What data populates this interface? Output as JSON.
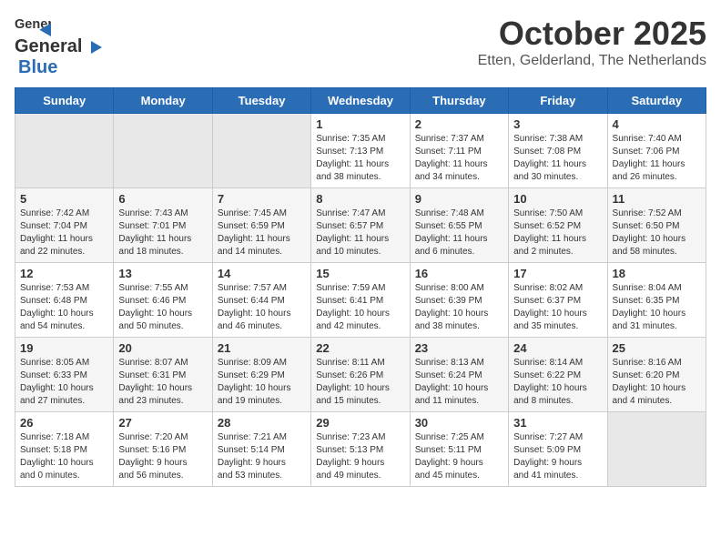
{
  "logo": {
    "general": "General",
    "blue": "Blue"
  },
  "title": "October 2025",
  "subtitle": "Etten, Gelderland, The Netherlands",
  "days_of_week": [
    "Sunday",
    "Monday",
    "Tuesday",
    "Wednesday",
    "Thursday",
    "Friday",
    "Saturday"
  ],
  "weeks": [
    [
      {
        "day": "",
        "info": ""
      },
      {
        "day": "",
        "info": ""
      },
      {
        "day": "",
        "info": ""
      },
      {
        "day": "1",
        "info": "Sunrise: 7:35 AM\nSunset: 7:13 PM\nDaylight: 11 hours\nand 38 minutes."
      },
      {
        "day": "2",
        "info": "Sunrise: 7:37 AM\nSunset: 7:11 PM\nDaylight: 11 hours\nand 34 minutes."
      },
      {
        "day": "3",
        "info": "Sunrise: 7:38 AM\nSunset: 7:08 PM\nDaylight: 11 hours\nand 30 minutes."
      },
      {
        "day": "4",
        "info": "Sunrise: 7:40 AM\nSunset: 7:06 PM\nDaylight: 11 hours\nand 26 minutes."
      }
    ],
    [
      {
        "day": "5",
        "info": "Sunrise: 7:42 AM\nSunset: 7:04 PM\nDaylight: 11 hours\nand 22 minutes."
      },
      {
        "day": "6",
        "info": "Sunrise: 7:43 AM\nSunset: 7:01 PM\nDaylight: 11 hours\nand 18 minutes."
      },
      {
        "day": "7",
        "info": "Sunrise: 7:45 AM\nSunset: 6:59 PM\nDaylight: 11 hours\nand 14 minutes."
      },
      {
        "day": "8",
        "info": "Sunrise: 7:47 AM\nSunset: 6:57 PM\nDaylight: 11 hours\nand 10 minutes."
      },
      {
        "day": "9",
        "info": "Sunrise: 7:48 AM\nSunset: 6:55 PM\nDaylight: 11 hours\nand 6 minutes."
      },
      {
        "day": "10",
        "info": "Sunrise: 7:50 AM\nSunset: 6:52 PM\nDaylight: 11 hours\nand 2 minutes."
      },
      {
        "day": "11",
        "info": "Sunrise: 7:52 AM\nSunset: 6:50 PM\nDaylight: 10 hours\nand 58 minutes."
      }
    ],
    [
      {
        "day": "12",
        "info": "Sunrise: 7:53 AM\nSunset: 6:48 PM\nDaylight: 10 hours\nand 54 minutes."
      },
      {
        "day": "13",
        "info": "Sunrise: 7:55 AM\nSunset: 6:46 PM\nDaylight: 10 hours\nand 50 minutes."
      },
      {
        "day": "14",
        "info": "Sunrise: 7:57 AM\nSunset: 6:44 PM\nDaylight: 10 hours\nand 46 minutes."
      },
      {
        "day": "15",
        "info": "Sunrise: 7:59 AM\nSunset: 6:41 PM\nDaylight: 10 hours\nand 42 minutes."
      },
      {
        "day": "16",
        "info": "Sunrise: 8:00 AM\nSunset: 6:39 PM\nDaylight: 10 hours\nand 38 minutes."
      },
      {
        "day": "17",
        "info": "Sunrise: 8:02 AM\nSunset: 6:37 PM\nDaylight: 10 hours\nand 35 minutes."
      },
      {
        "day": "18",
        "info": "Sunrise: 8:04 AM\nSunset: 6:35 PM\nDaylight: 10 hours\nand 31 minutes."
      }
    ],
    [
      {
        "day": "19",
        "info": "Sunrise: 8:05 AM\nSunset: 6:33 PM\nDaylight: 10 hours\nand 27 minutes."
      },
      {
        "day": "20",
        "info": "Sunrise: 8:07 AM\nSunset: 6:31 PM\nDaylight: 10 hours\nand 23 minutes."
      },
      {
        "day": "21",
        "info": "Sunrise: 8:09 AM\nSunset: 6:29 PM\nDaylight: 10 hours\nand 19 minutes."
      },
      {
        "day": "22",
        "info": "Sunrise: 8:11 AM\nSunset: 6:26 PM\nDaylight: 10 hours\nand 15 minutes."
      },
      {
        "day": "23",
        "info": "Sunrise: 8:13 AM\nSunset: 6:24 PM\nDaylight: 10 hours\nand 11 minutes."
      },
      {
        "day": "24",
        "info": "Sunrise: 8:14 AM\nSunset: 6:22 PM\nDaylight: 10 hours\nand 8 minutes."
      },
      {
        "day": "25",
        "info": "Sunrise: 8:16 AM\nSunset: 6:20 PM\nDaylight: 10 hours\nand 4 minutes."
      }
    ],
    [
      {
        "day": "26",
        "info": "Sunrise: 7:18 AM\nSunset: 5:18 PM\nDaylight: 10 hours\nand 0 minutes."
      },
      {
        "day": "27",
        "info": "Sunrise: 7:20 AM\nSunset: 5:16 PM\nDaylight: 9 hours\nand 56 minutes."
      },
      {
        "day": "28",
        "info": "Sunrise: 7:21 AM\nSunset: 5:14 PM\nDaylight: 9 hours\nand 53 minutes."
      },
      {
        "day": "29",
        "info": "Sunrise: 7:23 AM\nSunset: 5:13 PM\nDaylight: 9 hours\nand 49 minutes."
      },
      {
        "day": "30",
        "info": "Sunrise: 7:25 AM\nSunset: 5:11 PM\nDaylight: 9 hours\nand 45 minutes."
      },
      {
        "day": "31",
        "info": "Sunrise: 7:27 AM\nSunset: 5:09 PM\nDaylight: 9 hours\nand 41 minutes."
      },
      {
        "day": "",
        "info": ""
      }
    ]
  ]
}
